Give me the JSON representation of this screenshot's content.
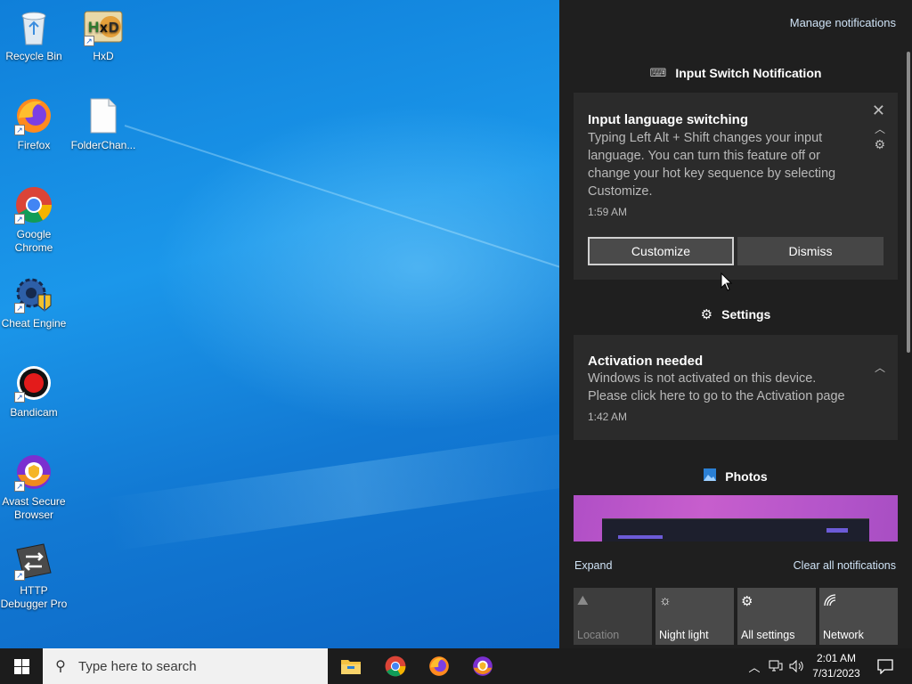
{
  "desktop": {
    "icons": [
      {
        "label": "Recycle Bin",
        "icon": "recycle-bin-icon"
      },
      {
        "label": "HxD",
        "icon": "hxd-icon"
      },
      {
        "label": "Firefox",
        "icon": "firefox-icon"
      },
      {
        "label": "FolderChan...",
        "icon": "file-icon"
      },
      {
        "label": "Google Chrome",
        "icon": "chrome-icon"
      },
      {
        "label": "Cheat Engine",
        "icon": "cheat-engine-icon"
      },
      {
        "label": "Bandicam",
        "icon": "bandicam-icon"
      },
      {
        "label": "Avast Secure Browser",
        "icon": "avast-browser-icon"
      },
      {
        "label": "HTTP Debugger Pro",
        "icon": "http-debugger-icon"
      }
    ]
  },
  "action_center": {
    "manage_label": "Manage notifications",
    "groups": [
      {
        "header": "Input Switch Notification",
        "icon": "keyboard-icon",
        "card": {
          "title": "Input language switching",
          "body_lines": [
            "Typing Left Alt + Shift changes your input",
            "language. You can turn this feature off or",
            "change your hot key sequence by selecting",
            "Customize."
          ],
          "time": "1:59 AM",
          "buttons": [
            "Customize",
            "Dismiss"
          ]
        }
      },
      {
        "header": "Settings",
        "icon": "gear-icon",
        "card": {
          "title": "Activation needed",
          "body_lines": [
            "Windows is not activated on this device.",
            "Please click here to go to the Activation page"
          ],
          "time": "1:42 AM"
        }
      },
      {
        "header": "Photos",
        "icon": "photos-icon"
      }
    ],
    "expand_label": "Expand",
    "clear_label": "Clear all notifications",
    "quick_actions": [
      {
        "label": "Location",
        "icon": "location-icon",
        "state": "off"
      },
      {
        "label": "Night light",
        "icon": "night-light-icon",
        "state": "on"
      },
      {
        "label": "All settings",
        "icon": "gear-icon",
        "state": "on"
      },
      {
        "label": "Network",
        "icon": "network-icon",
        "state": "on"
      }
    ]
  },
  "taskbar": {
    "search_placeholder": "Type here to search",
    "apps": [
      "file-explorer-icon",
      "chrome-icon",
      "firefox-icon",
      "avast-browser-icon"
    ],
    "time": "2:01 AM",
    "date": "7/31/2023"
  },
  "colors": {
    "action_center_bg": "#1f1f1f",
    "card_bg": "#2b2b2b",
    "link": "#cfe3f6",
    "taskbar_bg": "#1c1c1c"
  }
}
